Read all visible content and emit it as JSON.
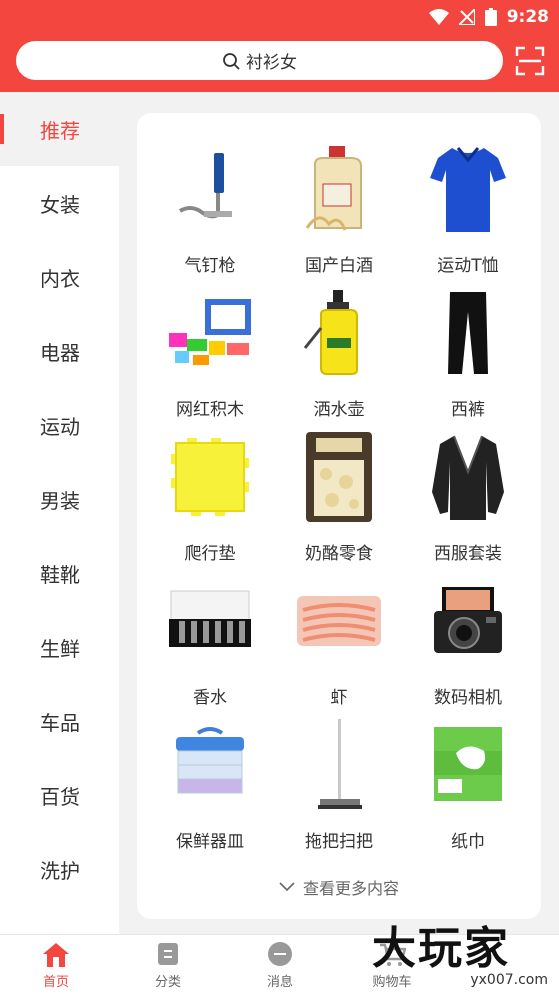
{
  "status": {
    "time": "9:28"
  },
  "search": {
    "query": "衬衫女"
  },
  "categories": [
    {
      "label": "推荐",
      "active": true
    },
    {
      "label": "女装"
    },
    {
      "label": "内衣"
    },
    {
      "label": "电器"
    },
    {
      "label": "运动"
    },
    {
      "label": "男装"
    },
    {
      "label": "鞋靴"
    },
    {
      "label": "生鲜"
    },
    {
      "label": "车品"
    },
    {
      "label": "百货"
    },
    {
      "label": "洗护"
    }
  ],
  "products": [
    {
      "name": "气钉枪",
      "icon": "nail-gun-icon"
    },
    {
      "name": "国产白酒",
      "icon": "liquor-jug-icon"
    },
    {
      "name": "运动T恤",
      "icon": "sport-tshirt-icon"
    },
    {
      "name": "网红积木",
      "icon": "building-blocks-icon"
    },
    {
      "name": "洒水壶",
      "icon": "sprayer-icon"
    },
    {
      "name": "西裤",
      "icon": "trousers-icon"
    },
    {
      "name": "爬行垫",
      "icon": "play-mat-icon"
    },
    {
      "name": "奶酪零食",
      "icon": "cheese-snack-icon"
    },
    {
      "name": "西服套装",
      "icon": "suit-jacket-icon"
    },
    {
      "name": "香水",
      "icon": "perfume-set-icon"
    },
    {
      "name": "虾",
      "icon": "shrimp-icon"
    },
    {
      "name": "数码相机",
      "icon": "camera-icon"
    },
    {
      "name": "保鲜器皿",
      "icon": "food-container-icon"
    },
    {
      "name": "拖把扫把",
      "icon": "mop-icon"
    },
    {
      "name": "纸巾",
      "icon": "tissue-icon"
    }
  ],
  "more_label": "查看更多内容",
  "nav": [
    {
      "label": "首页",
      "icon": "home-icon",
      "active": true
    },
    {
      "label": "分类",
      "icon": "category-icon"
    },
    {
      "label": "消息",
      "icon": "message-icon"
    },
    {
      "label": "购物车",
      "icon": "cart-icon"
    }
  ],
  "watermark": {
    "big": "大玩家",
    "small": "yx007.com"
  },
  "colors": {
    "accent": "#f2463f",
    "background": "#f2f2f2"
  }
}
